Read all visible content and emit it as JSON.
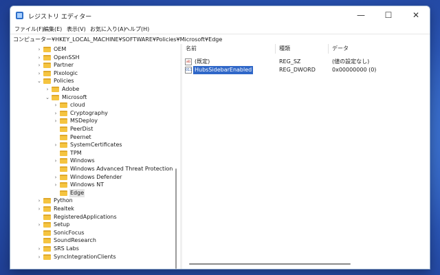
{
  "app": {
    "title": "レジストリ エディター"
  },
  "window_controls": {
    "minimize": "—",
    "maximize": "☐",
    "close": "✕"
  },
  "menu": [
    "ファイル(F)",
    "編集(E)",
    "表示(V)",
    "お気に入り(A)",
    "ヘルプ(H)"
  ],
  "address": "コンピューター¥HKEY_LOCAL_MACHINE¥SOFTWARE¥Policies¥Microsoft¥Edge",
  "tree": [
    {
      "label": "OEM",
      "chevron": "›"
    },
    {
      "label": "OpenSSH",
      "chevron": "›"
    },
    {
      "label": "Partner",
      "chevron": "›"
    },
    {
      "label": "Pixologic",
      "chevron": "›"
    },
    {
      "label": "Policies",
      "chevron": "⌄"
    },
    {
      "label": "Adobe",
      "chevron": "›"
    },
    {
      "label": "Microsoft",
      "chevron": "⌄"
    },
    {
      "label": "cloud",
      "chevron": "›"
    },
    {
      "label": "Cryptography",
      "chevron": "›"
    },
    {
      "label": "MSDeploy",
      "chevron": "›"
    },
    {
      "label": "PeerDist",
      "chevron": ""
    },
    {
      "label": "Peernet",
      "chevron": ""
    },
    {
      "label": "SystemCertificates",
      "chevron": "›"
    },
    {
      "label": "TPM",
      "chevron": ""
    },
    {
      "label": "Windows",
      "chevron": "›"
    },
    {
      "label": "Windows Advanced Threat Protection",
      "chevron": ""
    },
    {
      "label": "Windows Defender",
      "chevron": "›"
    },
    {
      "label": "Windows NT",
      "chevron": "›"
    },
    {
      "label": "Edge",
      "chevron": "",
      "selected": true
    },
    {
      "label": "Python",
      "chevron": "›"
    },
    {
      "label": "Realtek",
      "chevron": "›"
    },
    {
      "label": "RegisteredApplications",
      "chevron": ""
    },
    {
      "label": "Setup",
      "chevron": "›"
    },
    {
      "label": "SonicFocus",
      "chevron": ""
    },
    {
      "label": "SoundResearch",
      "chevron": ""
    },
    {
      "label": "SRS Labs",
      "chevron": "›"
    },
    {
      "label": "SyncIntegrationClients",
      "chevron": "›"
    }
  ],
  "list": {
    "columns": [
      "名前",
      "種類",
      "データ"
    ],
    "rows": [
      {
        "icon": "ab",
        "name": "(既定)",
        "type": "REG_SZ",
        "data": "(値の設定なし)"
      },
      {
        "icon": "011",
        "name": "HubsSidebarEnabled",
        "type": "REG_DWORD",
        "data": "0x00000000 (0)",
        "selected": true
      }
    ]
  }
}
